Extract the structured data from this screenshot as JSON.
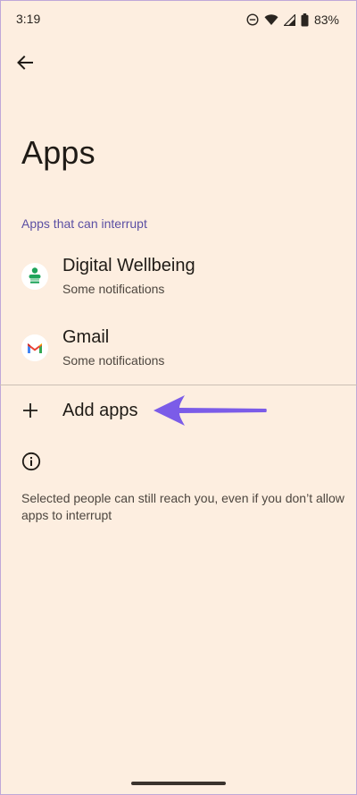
{
  "status_bar": {
    "time": "3:19",
    "battery": "83%"
  },
  "header": {
    "title": "Apps"
  },
  "section": {
    "label": "Apps that can interrupt"
  },
  "apps": [
    {
      "name": "Digital Wellbeing",
      "subtitle": "Some notifications",
      "icon": "digital-wellbeing-icon"
    },
    {
      "name": "Gmail",
      "subtitle": "Some notifications",
      "icon": "gmail-icon"
    }
  ],
  "add_apps": {
    "label": "Add apps"
  },
  "footer": {
    "text": "Selected people can still reach you, even if you don’t allow apps to interrupt"
  },
  "colors": {
    "background": "#fdeee0",
    "accent": "#5b4fa3",
    "arrow": "#7b5ce8"
  }
}
